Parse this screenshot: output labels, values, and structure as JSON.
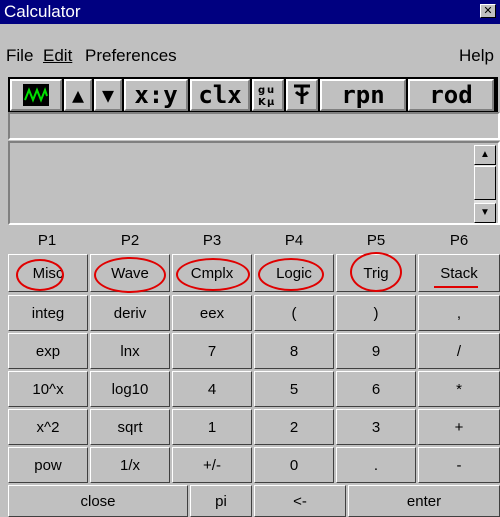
{
  "window": {
    "title": "Calculator",
    "close_glyph": "✕"
  },
  "menubar": {
    "items": [
      "File",
      "Edit",
      "Preferences"
    ],
    "help": "Help"
  },
  "toolbar": {
    "items": [
      {
        "label": "",
        "icon": "wave-icon"
      },
      {
        "label": "▲",
        "icon": "up-arrow-icon"
      },
      {
        "label": "▼",
        "icon": "down-arrow-icon"
      },
      {
        "label": "x:y",
        "icon": ""
      },
      {
        "label": "clx",
        "icon": ""
      },
      {
        "label": "",
        "icon": "unit-conversion-icon"
      },
      {
        "label": "",
        "icon": "function-icon"
      },
      {
        "label": "rpn",
        "icon": ""
      },
      {
        "label": "rod",
        "icon": ""
      }
    ]
  },
  "pages": {
    "labels": [
      "P1",
      "P2",
      "P3",
      "P4",
      "P5",
      "P6"
    ],
    "buttons": [
      "Misc",
      "Wave",
      "Cmplx",
      "Logic",
      "Trig",
      "Stack"
    ]
  },
  "keypad": {
    "rows": [
      [
        "integ",
        "deriv",
        "eex",
        "(",
        ")",
        ","
      ],
      [
        "exp",
        "lnx",
        "7",
        "8",
        "9",
        "/"
      ],
      [
        "10^x",
        "log10",
        "4",
        "5",
        "6",
        "*"
      ],
      [
        "x^2",
        "sqrt",
        "1",
        "2",
        "3",
        "+"
      ],
      [
        "pow",
        "1/x",
        "+/-",
        "0",
        ".",
        "-"
      ]
    ],
    "bottom": [
      "close",
      "pi",
      "<-",
      "enter"
    ]
  },
  "colors": {
    "titlebar": "#000080",
    "face": "#c0c0c0",
    "annotation": "#e00000"
  }
}
